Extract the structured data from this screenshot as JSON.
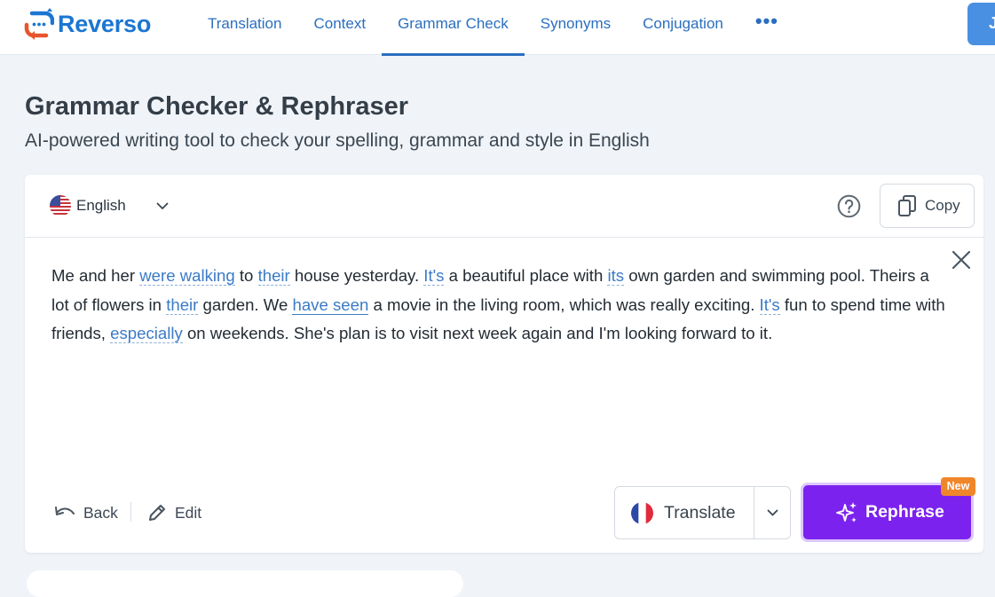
{
  "brand": {
    "name": "Reverso",
    "color": "#1b76d2",
    "accent": "#e8542b"
  },
  "nav": {
    "items": [
      {
        "label": "Translation"
      },
      {
        "label": "Context"
      },
      {
        "label": "Grammar Check",
        "active": true
      },
      {
        "label": "Synonyms"
      },
      {
        "label": "Conjugation"
      }
    ],
    "more_label": "•••",
    "login_label": "J"
  },
  "page": {
    "title": "Grammar Checker & Rephraser",
    "subtitle": "AI-powered writing tool to check your spelling, grammar and style in English"
  },
  "editor": {
    "language": "English",
    "language_icon": "us-flag-icon",
    "copy_label": "Copy",
    "text_segments": [
      "Me and her ",
      "were walking",
      " to ",
      "their",
      " house yesterday. ",
      "It's",
      " a beautiful place with ",
      "its",
      " own garden and swimming pool. Theirs a lot of flowers in ",
      "their",
      " garden. We ",
      "have seen",
      " a movie in the living room, which was really exciting. ",
      "It's",
      " fun to spend time with friends, ",
      "especially",
      " on weekends. She's plan is to visit next week again and I'm looking forward to it."
    ],
    "highlighted_segments": [
      1,
      3,
      5,
      7,
      9,
      11,
      13,
      15
    ]
  },
  "actions": {
    "back_label": "Back",
    "edit_label": "Edit",
    "translate_label": "Translate",
    "translate_icon": "fr-flag-icon",
    "rephrase_label": "Rephrase",
    "new_badge": "New"
  },
  "colors": {
    "nav_link": "#2a6fbf",
    "highlight": "#3b7bc6",
    "rephrase": "#7c22ee",
    "badge": "#f0862a",
    "background": "#f0f4f8"
  }
}
